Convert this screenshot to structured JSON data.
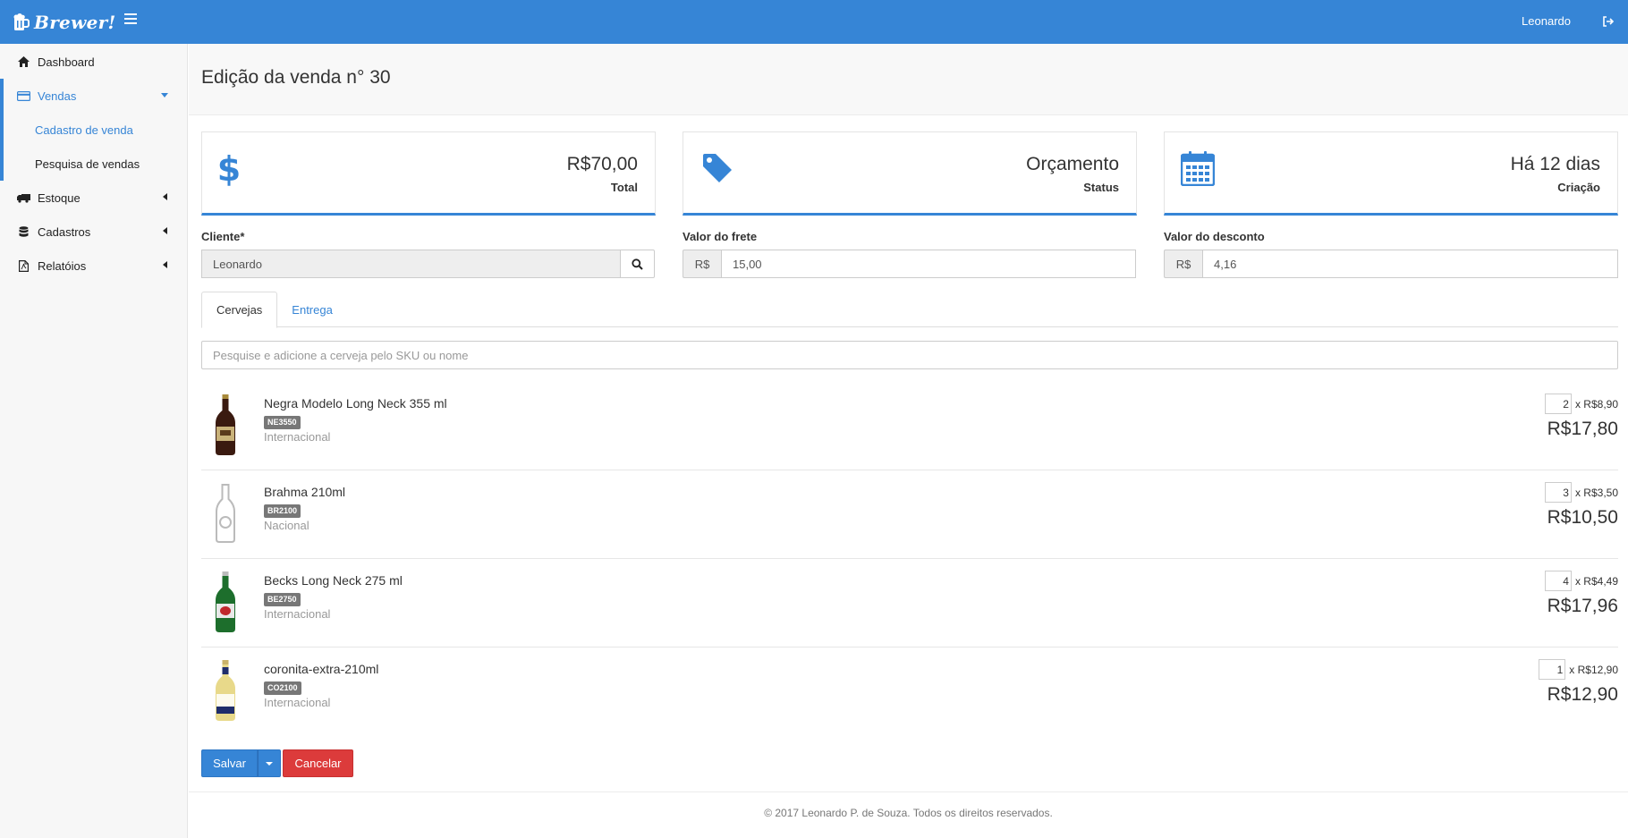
{
  "app": {
    "brand": "Brewer!",
    "user": "Leonardo",
    "accent": "#3685d6"
  },
  "sidebar": {
    "items": [
      {
        "label": "Dashboard",
        "icon": "home-icon"
      },
      {
        "label": "Vendas",
        "icon": "credit-card-icon",
        "expanded": true
      },
      {
        "label": "Estoque",
        "icon": "truck-icon"
      },
      {
        "label": "Cadastros",
        "icon": "database-icon"
      },
      {
        "label": "Relatóios",
        "icon": "file-pdf-icon"
      }
    ],
    "sub_items": [
      {
        "label": "Cadastro de venda",
        "active": true
      },
      {
        "label": "Pesquisa de vendas",
        "active": false
      }
    ]
  },
  "page": {
    "title": "Edição da venda n° 30"
  },
  "cards": {
    "total": {
      "value": "R$70,00",
      "label": "Total",
      "icon": "dollar-icon"
    },
    "status": {
      "value": "Orçamento",
      "label": "Status",
      "icon": "tag-icon"
    },
    "created": {
      "value": "Há 12 dias",
      "label": "Criação",
      "icon": "calendar-icon"
    }
  },
  "form": {
    "client": {
      "label": "Cliente*",
      "value": "Leonardo"
    },
    "freight": {
      "label": "Valor do frete",
      "prefix": "R$",
      "value": "15,00"
    },
    "discount": {
      "label": "Valor do desconto",
      "prefix": "R$",
      "value": "4,16"
    }
  },
  "tabs": [
    {
      "label": "Cervejas",
      "active": true
    },
    {
      "label": "Entrega",
      "active": false
    }
  ],
  "search": {
    "placeholder": "Pesquise e adicione a cerveja pelo SKU ou nome"
  },
  "items": [
    {
      "name": "Negra Modelo Long Neck 355 ml",
      "sku": "NE3550",
      "origin": "Internacional",
      "qty": "2",
      "unit_price": "x R$8,90",
      "subtotal": "R$17,80"
    },
    {
      "name": "Brahma 210ml",
      "sku": "BR2100",
      "origin": "Nacional",
      "qty": "3",
      "unit_price": "x R$3,50",
      "subtotal": "R$10,50"
    },
    {
      "name": "Becks Long Neck 275 ml",
      "sku": "BE2750",
      "origin": "Internacional",
      "qty": "4",
      "unit_price": "x R$4,49",
      "subtotal": "R$17,96"
    },
    {
      "name": "coronita-extra-210ml",
      "sku": "CO2100",
      "origin": "Internacional",
      "qty": "1",
      "unit_price": "x R$12,90",
      "subtotal": "R$12,90"
    }
  ],
  "buttons": {
    "save": "Salvar",
    "cancel": "Cancelar"
  },
  "footer": {
    "text": "© 2017 Leonardo P. de Souza. Todos os direitos reservados."
  }
}
